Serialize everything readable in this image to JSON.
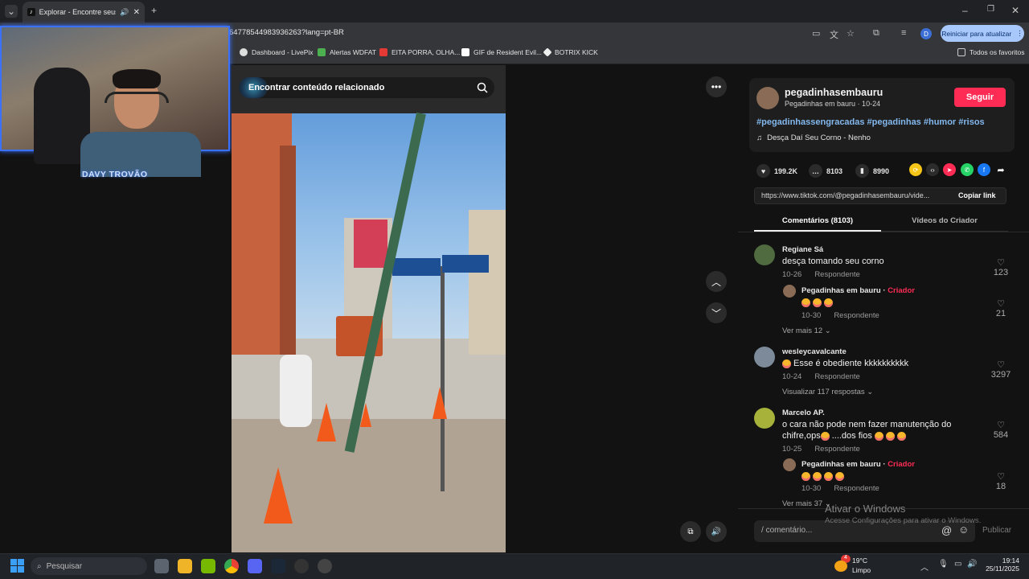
{
  "browser": {
    "tab_title": "Explorar - Encontre seus ví",
    "url": "6477854498393626​3?lang=pt-BR",
    "restart_label": "Reiniciar para atualizar",
    "profile_initial": "D",
    "bookmarks": [
      "Dashboard - LivePix",
      "Alertas WDFAT",
      "EITA PORRA, OLHA...",
      "GIF de Resident Evil...",
      "BOTRIX KICK"
    ],
    "all_bookmarks": "Todos os favoritos"
  },
  "webcam": {
    "label": "DAVY TROVÃO"
  },
  "video": {
    "search_overlay": "Encontrar conteúdo relacionado"
  },
  "post": {
    "username": "pegadinhasembauru",
    "nickname": "Pegadinhas em bauru · 10-24",
    "follow_label": "Seguir",
    "hashtags": "#pegadinhassengracadas #pegadinhas #humor #risos",
    "music": "Desça Daí Seu Corno - Nenho",
    "likes": "199.2K",
    "comments": "8103",
    "saves": "8990",
    "link": "https://www.tiktok.com/@pegadinhasembauru/vide...",
    "copy_link": "Copiar link",
    "tab_comments": "Comentários (8103)",
    "tab_videos": "Vídeos do Criador"
  },
  "comments": [
    {
      "name": "Regiane Sá",
      "text": "desça tomando seu corno",
      "date": "10-26",
      "reply": "Respondente",
      "likes": "123"
    },
    {
      "name": "Pegadinhas em bauru",
      "creator": "Criador",
      "date": "10-30",
      "reply": "Respondente",
      "likes": "21",
      "more": "Ver mais 12"
    },
    {
      "name": "wesleycavalcante",
      "text": "Esse é obediente kkkkkkkkkk",
      "date": "10-24",
      "reply": "Respondente",
      "likes": "3297",
      "more": "Visualizar 117 respostas"
    },
    {
      "name": "Marcelo AP.",
      "text1": "o cara não pode nem fazer manutenção do",
      "text2": "chifre,ops",
      "text3": "....dos fios",
      "date": "10-25",
      "reply": "Respondente",
      "likes": "584"
    },
    {
      "name": "Pegadinhas em bauru",
      "creator": "Criador",
      "date": "10-30",
      "reply": "Respondente",
      "likes": "18",
      "more": "Ver mais 37"
    }
  ],
  "composer": {
    "placeholder": "comentário...",
    "publish": "Publicar"
  },
  "watermark": {
    "line1": "Ativar o Windows",
    "line2": "Acesse Configurações para ativar o Windows."
  },
  "taskbar": {
    "search": "Pesquisar",
    "weather_temp": "19°C",
    "weather_desc": "Limpo",
    "time": "19:14",
    "date": "25/11/2025",
    "notif": "4"
  }
}
